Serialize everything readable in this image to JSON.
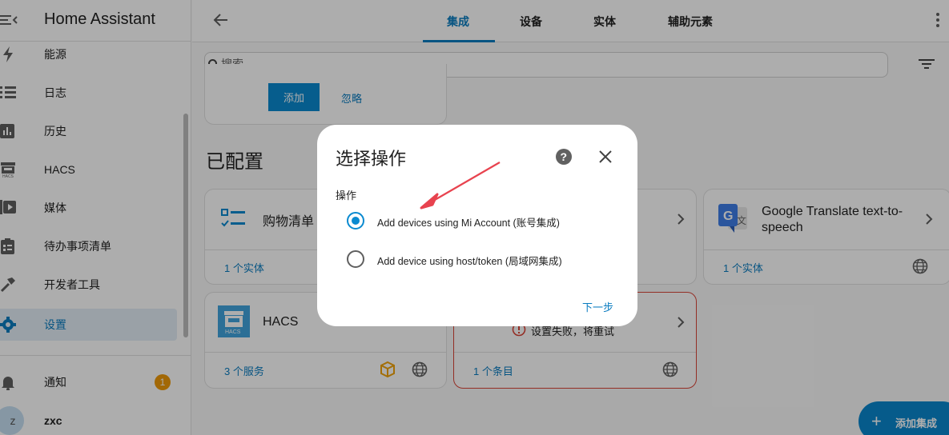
{
  "sidebar": {
    "title": "Home Assistant",
    "items": [
      {
        "label": "能源",
        "icon": "lightning-icon"
      },
      {
        "label": "日志",
        "icon": "list-icon"
      },
      {
        "label": "历史",
        "icon": "chart-icon"
      },
      {
        "label": "HACS",
        "icon": "hacs-icon"
      },
      {
        "label": "媒体",
        "icon": "media-icon"
      },
      {
        "label": "待办事项清单",
        "icon": "clipboard-icon"
      },
      {
        "label": "开发者工具",
        "icon": "hammer-icon"
      },
      {
        "label": "设置",
        "icon": "gear-icon"
      }
    ],
    "notifications_label": "通知",
    "notifications_count": "1",
    "user_initial": "z",
    "user_name": "zxc"
  },
  "header": {
    "tabs": [
      "集成",
      "设备",
      "实体",
      "辅助元素"
    ],
    "active_tab": "集成"
  },
  "search": {
    "placeholder": "搜索"
  },
  "discovered": {
    "add_label": "添加",
    "ignore_label": "忽略"
  },
  "configured": {
    "title": "已配置",
    "cards": [
      {
        "title": "购物清单",
        "link": "1 个实体"
      },
      {
        "title": "Google Translate text-to-speech",
        "link": "1 个实体"
      },
      {
        "title": "HACS",
        "link": "3 个服务"
      },
      {
        "error": "设置失败，将重试",
        "link": "1 个条目"
      }
    ]
  },
  "dialog": {
    "title": "选择操作",
    "field_label": "操作",
    "options": [
      {
        "label": "Add devices using Mi Account (账号集成)",
        "checked": true
      },
      {
        "label": "Add device using host/token (局域网集成)",
        "checked": false
      }
    ],
    "next_label": "下一步"
  },
  "fab": {
    "label": "添加集成"
  },
  "colors": {
    "accent": "#0a7cc0",
    "badge": "#ef9a09",
    "arrow": "#e8434f"
  }
}
